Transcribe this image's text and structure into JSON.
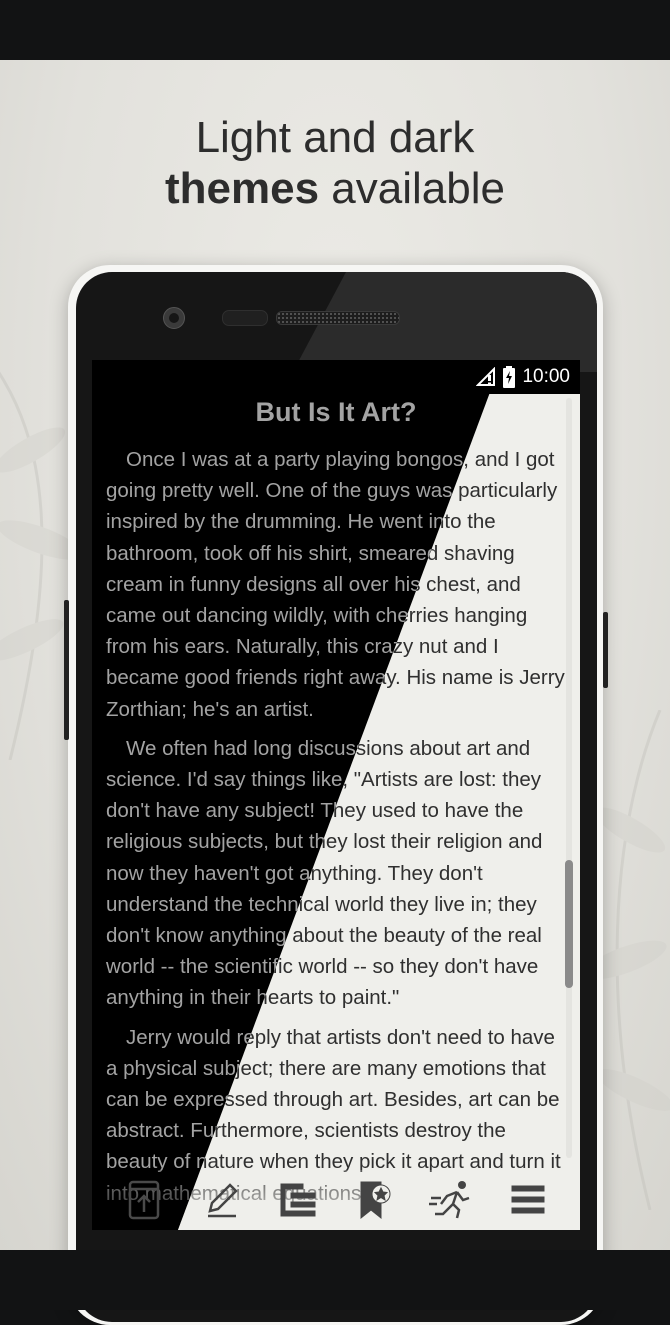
{
  "headline": {
    "line1": "Light and dark",
    "line2_bold": "themes",
    "line2_rest": " available"
  },
  "status_bar": {
    "time": "10:00",
    "icons": [
      "signal-icon",
      "battery-charging-icon"
    ]
  },
  "book": {
    "title": "But Is It Art?",
    "paragraphs": [
      "Once I was at a party playing bongos, and I got going pretty well. One of the guys was particularly inspired by the drumming. He went into the bathroom, took off his shirt, smeared shaving cream in funny designs all over his chest, and came out dancing wildly, with cherries hanging from his ears. Naturally, this crazy nut and I became good friends right away. His name is Jerry Zorthian; he's an artist.",
      "We often had long discussions about art and science. I'd say things like, \"Artists are lost: they don't have any subject! They used to have the religious subjects, but they lost their religion and now they haven't got anything. They don't understand the technical world they live in; they don't know anything about the beauty of the real world -- the scientific world -- so they don't have anything in their hearts to paint.\"",
      "Jerry would reply that artists don't need to have a physical subject; there are many emotions that can be expressed through art. Besides, art can be abstract. Furthermore, scientists destroy the beauty of nature when they pick it apart and turn it into mathematical equations."
    ]
  },
  "toolbar": {
    "items": [
      {
        "name": "open-book-button",
        "icon": "phone-upload-icon"
      },
      {
        "name": "annotate-button",
        "icon": "pencil-icon"
      },
      {
        "name": "contents-button",
        "icon": "table-of-contents-icon"
      },
      {
        "name": "bookmarks-button",
        "icon": "bookmark-star-icon"
      },
      {
        "name": "autoscroll-button",
        "icon": "running-man-icon"
      },
      {
        "name": "menu-button",
        "icon": "hamburger-menu-icon"
      }
    ]
  },
  "colors": {
    "dark_theme_bg": "#000000",
    "dark_theme_text": "#a3a3a3",
    "light_theme_bg": "#efefeb",
    "light_theme_text": "#2f2f2f"
  }
}
